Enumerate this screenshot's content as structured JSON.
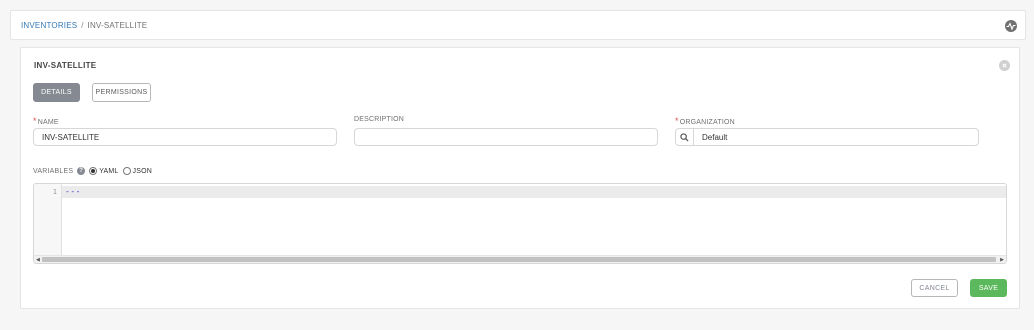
{
  "breadcrumb": {
    "parent": "INVENTORIES",
    "separator": "/",
    "current": "INV-SATELLITE"
  },
  "header": {
    "activity_icon": "activity-stream-icon"
  },
  "panel": {
    "title": "INV-SATELLITE",
    "close_icon": "close-icon"
  },
  "tabs": [
    {
      "label": "DETAILS",
      "active": true
    },
    {
      "label": "PERMISSIONS",
      "active": false
    }
  ],
  "form": {
    "required_marker": "*",
    "name": {
      "label": "NAME",
      "value": "INV-SATELLITE",
      "required": true
    },
    "description": {
      "label": "DESCRIPTION",
      "value": "",
      "required": false
    },
    "organization": {
      "label": "ORGANIZATION",
      "value": "Default",
      "required": true,
      "search_icon": "search-icon"
    },
    "variables": {
      "label": "VARIABLES",
      "help_icon": "?",
      "formats": [
        {
          "label": "YAML",
          "selected": true
        },
        {
          "label": "JSON",
          "selected": false
        }
      ],
      "line_number": "1",
      "content": "---"
    }
  },
  "actions": {
    "cancel_label": "CANCEL",
    "save_label": "SAVE"
  },
  "colors": {
    "accent_link": "#337ab7",
    "tab_active_bg": "#848992",
    "save_bg": "#5cb85c",
    "required": "#d9534f"
  }
}
